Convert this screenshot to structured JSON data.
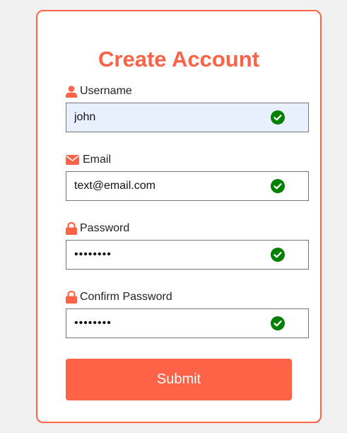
{
  "form": {
    "title": "Create Account",
    "fields": [
      {
        "label": "Username",
        "value": "john",
        "type": "text",
        "icon": "user-icon",
        "valid": true
      },
      {
        "label": "Email",
        "value": "text@email.com",
        "type": "text",
        "icon": "envelope-icon",
        "valid": true
      },
      {
        "label": "Password",
        "value": "12345678",
        "type": "password",
        "icon": "lock-icon",
        "valid": true
      },
      {
        "label": "Confirm Password",
        "value": "12345678",
        "type": "password",
        "icon": "lock-icon",
        "valid": true
      }
    ],
    "submit_label": "Submit"
  },
  "colors": {
    "accent": "#ff6347",
    "valid": "#008000",
    "autofill_bg": "#e8f0fe"
  }
}
